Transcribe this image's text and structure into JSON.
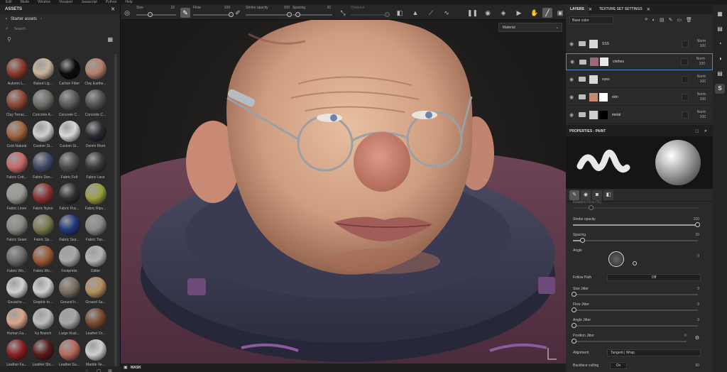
{
  "menu": [
    "Edit",
    "Mode",
    "Window",
    "Viewport",
    "Javascript",
    "Python",
    "Help"
  ],
  "toolbar": {
    "size_label": "Size",
    "size_value": "32",
    "flow_label": "Flow",
    "flow_value": "100",
    "stroke_label": "Stroke opacity",
    "stroke_value": "100",
    "spacing_label": "Spacing",
    "spacing_value": "20",
    "distance_label": "Distance"
  },
  "assets": {
    "title": "ASSETS",
    "subtitle": "Starter assets",
    "search_placeholder": "Search",
    "items": [
      {
        "label": "Autumn L...",
        "color": "#8b3a2a"
      },
      {
        "label": "Baked Lig...",
        "color": "#c9b39a"
      },
      {
        "label": "Carbon Fiber",
        "color": "#0c0c0c"
      },
      {
        "label": "Clay Earthe...",
        "color": "#b5806a"
      },
      {
        "label": "Clay Terrac...",
        "color": "#8e4a36"
      },
      {
        "label": "Concrete A...",
        "color": "#6e6e6a"
      },
      {
        "label": "Concrete C...",
        "color": "#5a5a58"
      },
      {
        "label": "Concrete C...",
        "color": "#545250"
      },
      {
        "label": "Cork Natural",
        "color": "#a0663e"
      },
      {
        "label": "Custom St...",
        "color": "#cfcfcf"
      },
      {
        "label": "Custom St...",
        "color": "#d8d8d8"
      },
      {
        "label": "Denim Rivet",
        "color": "#2a2c33"
      },
      {
        "label": "Fabric Cott...",
        "color": "#c96a6a"
      },
      {
        "label": "Fabric Den...",
        "color": "#3e4a66"
      },
      {
        "label": "Fabric Felt",
        "color": "#4c4c4c"
      },
      {
        "label": "Fabric Lace",
        "color": "#3a3a3a"
      },
      {
        "label": "Fabric Linen",
        "color": "#9a9a92"
      },
      {
        "label": "Fabric Nylon",
        "color": "#8c3333"
      },
      {
        "label": "Fabric Puc...",
        "color": "#2f2f2f"
      },
      {
        "label": "Fabric Rips...",
        "color": "#9aa040"
      },
      {
        "label": "Fabric Seam",
        "color": "#888884"
      },
      {
        "label": "Fabric Sp...",
        "color": "#7a7a50"
      },
      {
        "label": "Fabric Sep...",
        "color": "#233a7a"
      },
      {
        "label": "Fabric Top...",
        "color": "#8a8a8a"
      },
      {
        "label": "Fabric Wo...",
        "color": "#6c6c6a"
      },
      {
        "label": "Fabric Wo...",
        "color": "#9a5a38"
      },
      {
        "label": "Footprints",
        "color": "#a8a8a8"
      },
      {
        "label": "Glitter",
        "color": "#b4b4b4"
      },
      {
        "label": "Gouache ...",
        "color": "#d0d0d0"
      },
      {
        "label": "Graphic to...",
        "color": "#cfcfcf"
      },
      {
        "label": "Ground Ir...",
        "color": "#7a6e62"
      },
      {
        "label": "Ground Sa...",
        "color": "#b5905e"
      },
      {
        "label": "Human Fa...",
        "color": "#d9a58a"
      },
      {
        "label": "Ivy Branch",
        "color": "#bdbdbd"
      },
      {
        "label": "Large Rust...",
        "color": "#a6a6a6"
      },
      {
        "label": "Leather Dr...",
        "color": "#7a4a30"
      },
      {
        "label": "Leather Fa...",
        "color": "#8a2020"
      },
      {
        "label": "Leather Shi...",
        "color": "#5a1a1a"
      },
      {
        "label": "Leather Su...",
        "color": "#b66a5a"
      },
      {
        "label": "Marble Ve...",
        "color": "#cfcfcf"
      }
    ]
  },
  "viewport": {
    "material_select": "Material"
  },
  "mask_label": "MASK",
  "layers": {
    "tabs": [
      "LAYERS",
      "TEXTURE SET SETTINGS"
    ],
    "channel": "Base color",
    "blend": "Norm",
    "opacity": "100",
    "rows": [
      {
        "name": "SSS",
        "thumb": "#d8d8d8",
        "mask": "",
        "selected": false
      },
      {
        "name": "clothes",
        "thumb": "#9a6a78",
        "mask": "#e8e8e8",
        "selected": true
      },
      {
        "name": "eyes",
        "thumb": "#d8d8d8",
        "mask": "",
        "selected": false
      },
      {
        "name": "skin",
        "thumb": "#c48a6a",
        "mask": "#ffffff",
        "selected": false
      },
      {
        "name": "metal",
        "thumb": "#cfcfcf",
        "mask": "#000000",
        "selected": false
      }
    ]
  },
  "properties": {
    "title": "PROPERTIES - PAINT",
    "partial_label": "Rotation Flow (%)",
    "stroke_opacity_label": "Stroke opacity",
    "stroke_opacity_value": "100",
    "spacing_label": "Spacing",
    "spacing_value": "20",
    "angle_label": "Angle",
    "angle_value": "0",
    "follow_path_label": "Follow Path",
    "follow_path_value": "Off",
    "size_jitter_label": "Size Jitter",
    "size_jitter_value": "0",
    "flow_jitter_label": "Flow Jitter",
    "flow_jitter_value": "0",
    "angle_jitter_label": "Angle Jitter",
    "angle_jitter_value": "0",
    "position_jitter_label": "Position Jitter",
    "position_jitter_value": "0",
    "alignment_label": "Alignment",
    "alignment_value": "Tangent | Wrap",
    "backface_label": "Backface culling",
    "backface_value": "On",
    "backface_number": "90"
  }
}
